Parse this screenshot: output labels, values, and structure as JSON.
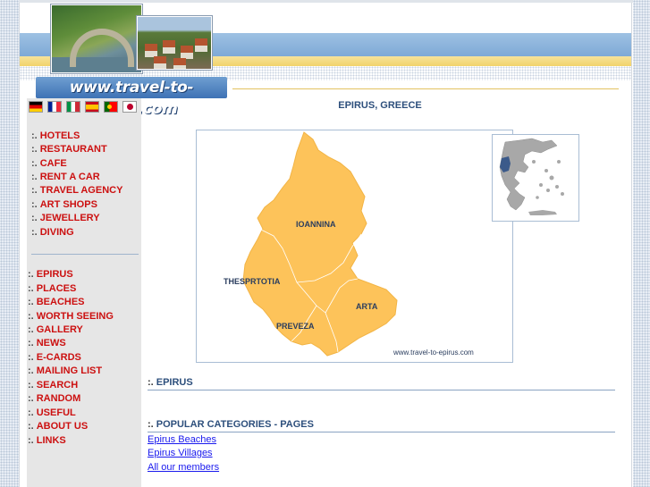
{
  "header": {
    "logo_text": "www.travel-to-epirus.com"
  },
  "flags": [
    "german-flag-icon",
    "french-flag-icon",
    "italian-flag-icon",
    "spanish-flag-icon",
    "portuguese-flag-icon",
    "japanese-flag-icon"
  ],
  "nav_group_1": [
    {
      "label": "HOTELS"
    },
    {
      "label": "RESTAURANT"
    },
    {
      "label": "CAFE"
    },
    {
      "label": "RENT A CAR"
    },
    {
      "label": "TRAVEL AGENCY"
    },
    {
      "label": "ART SHOPS"
    },
    {
      "label": "JEWELLERY"
    },
    {
      "label": "DIVING"
    }
  ],
  "nav_group_2": [
    {
      "label": "EPIRUS"
    },
    {
      "label": "PLACES"
    },
    {
      "label": "BEACHES"
    },
    {
      "label": "WORTH SEEING"
    },
    {
      "label": "GALLERY"
    },
    {
      "label": "NEWS"
    },
    {
      "label": "E-CARDS"
    },
    {
      "label": "MAILING LIST"
    },
    {
      "label": "SEARCH"
    },
    {
      "label": "RANDOM"
    },
    {
      "label": "USEFUL"
    },
    {
      "label": "ABOUT US"
    },
    {
      "label": "LINKS"
    }
  ],
  "nav_bullet": ":.",
  "main": {
    "title": "EPIRUS, GREECE",
    "map": {
      "regions": [
        "IOANNINA",
        "THESPRTOTIA",
        "ARTA",
        "PREVEZA"
      ],
      "watermark": "www.travel-to-epirus.com"
    },
    "section_epirus": "EPIRUS",
    "section_popular": "POPULAR CATEGORIES - PAGES",
    "links": [
      "Epirus Beaches",
      "Epirus Villages",
      "All our members"
    ]
  },
  "colors": {
    "nav_text": "#cc1010",
    "heading_text": "#2d4f7c",
    "map_fill": "#fdc35a",
    "link": "#1a1aee"
  }
}
